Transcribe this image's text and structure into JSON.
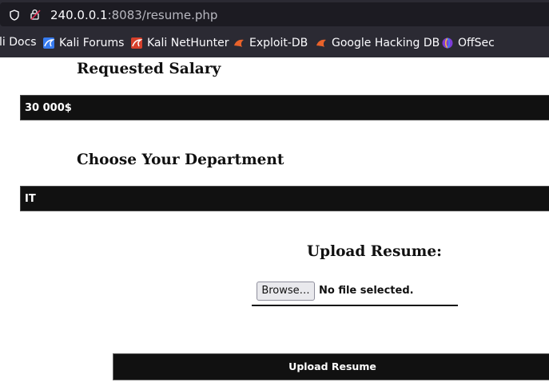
{
  "browser": {
    "url_host": "240.0.0.1",
    "url_path": ":8083/resume.php",
    "bookmarks": [
      {
        "label": "li Docs"
      },
      {
        "label": "Kali Forums"
      },
      {
        "label": "Kali NetHunter"
      },
      {
        "label": "Exploit-DB"
      },
      {
        "label": "Google Hacking DB"
      },
      {
        "label": "OffSec"
      }
    ]
  },
  "form": {
    "salary_heading": "Requested Salary",
    "salary_value": "30 000$",
    "department_heading": "Choose Your Department",
    "department_value": "IT",
    "upload_heading": "Upload Resume:",
    "browse_label": "Browse…",
    "file_status": "No file selected.",
    "submit_label": "Upload Resume"
  },
  "colors": {
    "field_background": "#111111",
    "page_background": "#ffffff",
    "browser_chrome": "#2b2a33"
  },
  "icons": [
    "shield-icon",
    "lock-warning-icon",
    "kali-dragon-icon",
    "exploit-db-icon",
    "offsec-icon"
  ]
}
